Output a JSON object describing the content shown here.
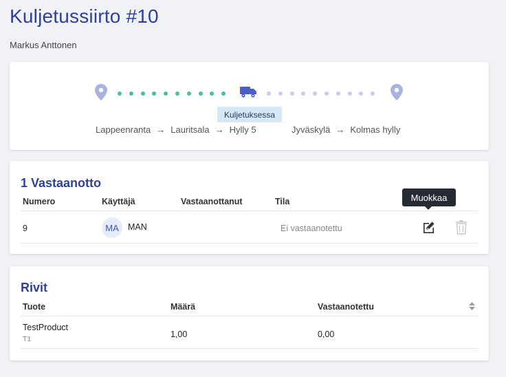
{
  "page": {
    "title": "Kuljetussiirto #10",
    "subtitle": "Markus Anttonen"
  },
  "route": {
    "status": "Kuljetuksessa",
    "from": {
      "location": "Lappeenranta",
      "sub": "Lauritsala",
      "shelf": "Hylly 5"
    },
    "to": {
      "location": "Jyväskylä",
      "shelf": "Kolmas hylly"
    },
    "colors": {
      "done": "#48c28a",
      "todo": "#c9cde8",
      "truck": "#4a5fc8",
      "pin": "#aab2de"
    }
  },
  "receipts": {
    "title": "1 Vastaanotto",
    "columns": [
      "Numero",
      "Käyttäjä",
      "Vastaanottanut",
      "Tila"
    ],
    "rows": [
      {
        "number": "9",
        "avatar": "MA",
        "user": "MAN",
        "received_by": "",
        "state": "Ei vastaanotettu"
      }
    ],
    "tooltip": "Muokkaa",
    "icons": {
      "edit": "edit-icon",
      "delete": "trash-icon"
    }
  },
  "rows": {
    "title": "Rivit",
    "columns": [
      "Tuote",
      "Määrä",
      "Vastaanotettu"
    ],
    "items": [
      {
        "product": "TestProduct",
        "code": "T1",
        "quantity": "1,00",
        "received": "0,00"
      }
    ]
  }
}
